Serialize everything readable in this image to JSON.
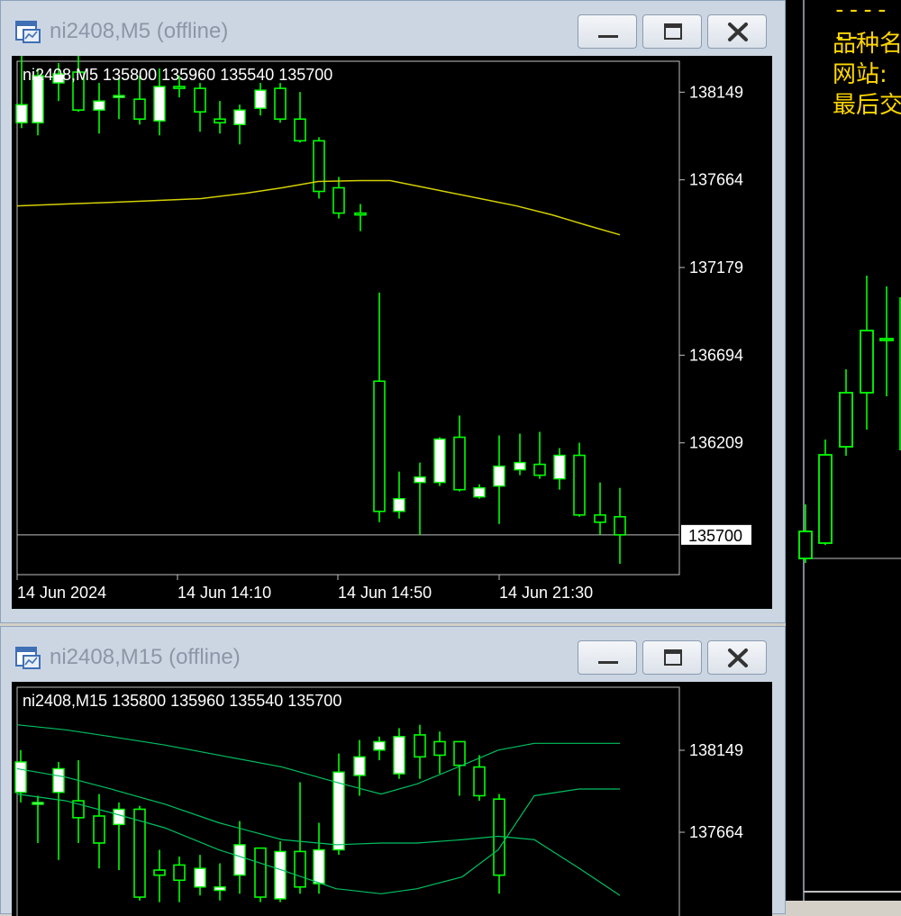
{
  "colors": {
    "chart_bg": "#000000",
    "bull_body": "#ffffff",
    "wick": "#00ff00",
    "ma_line": "#d4d000",
    "band_line": "#00c060",
    "grid_line": "#c0c0c0",
    "right_panel_text": "#ffd700"
  },
  "window_m5": {
    "title": "ni2408,M5 (offline)",
    "icon": "chart-window-icon",
    "buttons": [
      "minimize-icon",
      "maximize-icon",
      "close-icon"
    ],
    "info_line": "ni2408,M5  135800 135960 135540 135700",
    "price_labels": [
      "138149",
      "137664",
      "137179",
      "136694",
      "136209"
    ],
    "current_price": "135700",
    "time_labels": [
      "14 Jun 2024",
      "14 Jun 14:10",
      "14 Jun 14:50",
      "14 Jun 21:30"
    ]
  },
  "window_m15": {
    "title": "ni2408,M15 (offline)",
    "icon": "chart-window-icon",
    "buttons": [
      "minimize-icon",
      "maximize-icon",
      "close-icon"
    ],
    "info_line": "ni2408,M15  135800 135960 135540 135700",
    "price_labels": [
      "138149",
      "137664"
    ]
  },
  "right_panel": {
    "lines": [
      "品种名",
      "网站:",
      "最后交"
    ]
  },
  "chart_data": [
    {
      "type": "candlestick",
      "symbol": "ni2408",
      "timeframe": "M5",
      "ylim": [
        135480,
        138400
      ],
      "yticks": [
        138149,
        137664,
        137179,
        136694,
        136209
      ],
      "last_price": 135700,
      "candles": [
        {
          "o": 137980,
          "c": 138080,
          "h": 138350,
          "l": 137950
        },
        {
          "o": 137980,
          "c": 138240,
          "h": 138280,
          "l": 137910
        },
        {
          "o": 138200,
          "c": 138250,
          "h": 138310,
          "l": 138100
        },
        {
          "o": 138260,
          "c": 138050,
          "h": 138370,
          "l": 138040
        },
        {
          "o": 138050,
          "c": 138100,
          "h": 138200,
          "l": 137920
        },
        {
          "o": 138120,
          "c": 138130,
          "h": 138230,
          "l": 138000
        },
        {
          "o": 138110,
          "c": 138000,
          "h": 138240,
          "l": 137970
        },
        {
          "o": 137990,
          "c": 138180,
          "h": 138280,
          "l": 137910
        },
        {
          "o": 138180,
          "c": 138170,
          "h": 138240,
          "l": 138120
        },
        {
          "o": 138170,
          "c": 138040,
          "h": 138200,
          "l": 137930
        },
        {
          "o": 138000,
          "c": 137980,
          "h": 138100,
          "l": 137920
        },
        {
          "o": 137970,
          "c": 138050,
          "h": 138080,
          "l": 137860
        },
        {
          "o": 138060,
          "c": 138160,
          "h": 138200,
          "l": 138020
        },
        {
          "o": 138170,
          "c": 138000,
          "h": 138200,
          "l": 137980
        },
        {
          "o": 138000,
          "c": 137880,
          "h": 138150,
          "l": 137870
        },
        {
          "o": 137880,
          "c": 137600,
          "h": 137900,
          "l": 137560
        },
        {
          "o": 137620,
          "c": 137480,
          "h": 137680,
          "l": 137450
        },
        {
          "o": 137480,
          "c": 137470,
          "h": 137530,
          "l": 137380
        },
        {
          "o": 136550,
          "c": 135830,
          "h": 137040,
          "l": 135770
        },
        {
          "o": 135830,
          "c": 135900,
          "h": 136050,
          "l": 135790
        },
        {
          "o": 135990,
          "c": 136020,
          "h": 136100,
          "l": 135700
        },
        {
          "o": 135990,
          "c": 136230,
          "h": 136240,
          "l": 135970
        },
        {
          "o": 136240,
          "c": 135950,
          "h": 136360,
          "l": 135940
        },
        {
          "o": 135910,
          "c": 135960,
          "h": 135980,
          "l": 135900
        },
        {
          "o": 135970,
          "c": 136080,
          "h": 136250,
          "l": 135760
        },
        {
          "o": 136060,
          "c": 136100,
          "h": 136260,
          "l": 136030
        },
        {
          "o": 136090,
          "c": 136030,
          "h": 136270,
          "l": 136010
        },
        {
          "o": 136010,
          "c": 136140,
          "h": 136180,
          "l": 135950
        },
        {
          "o": 136140,
          "c": 135810,
          "h": 136210,
          "l": 135800
        },
        {
          "o": 135810,
          "c": 135770,
          "h": 135990,
          "l": 135700
        },
        {
          "o": 135800,
          "c": 135700,
          "h": 135960,
          "l": 135540
        }
      ],
      "moving_average": [
        137520,
        137530,
        137545,
        137560,
        137590,
        137620,
        137655,
        137660,
        137660,
        137610,
        137560,
        137520,
        137470,
        137410,
        137360
      ]
    },
    {
      "type": "candlestick",
      "symbol": "ni2408",
      "timeframe": "M15",
      "ylim": [
        137250,
        138450
      ],
      "yticks": [
        138149,
        137664
      ],
      "candles": [
        {
          "o": 137900,
          "c": 138080,
          "h": 138150,
          "l": 137840
        },
        {
          "o": 137830,
          "c": 137840,
          "h": 137880,
          "l": 137600
        },
        {
          "o": 137900,
          "c": 138040,
          "h": 138080,
          "l": 137500
        },
        {
          "o": 137850,
          "c": 137750,
          "h": 138090,
          "l": 137600
        },
        {
          "o": 137760,
          "c": 137600,
          "h": 137890,
          "l": 137450
        },
        {
          "o": 137710,
          "c": 137800,
          "h": 137840,
          "l": 137440
        },
        {
          "o": 137800,
          "c": 137280,
          "h": 137820,
          "l": 137260
        },
        {
          "o": 137440,
          "c": 137410,
          "h": 137560,
          "l": 137250
        },
        {
          "o": 137470,
          "c": 137380,
          "h": 137520,
          "l": 137250
        },
        {
          "o": 137340,
          "c": 137450,
          "h": 137530,
          "l": 137290
        },
        {
          "o": 137320,
          "c": 137340,
          "h": 137480,
          "l": 137260
        },
        {
          "o": 137410,
          "c": 137590,
          "h": 137730,
          "l": 137300
        },
        {
          "o": 137570,
          "c": 137280,
          "h": 137570,
          "l": 137250
        },
        {
          "o": 137270,
          "c": 137550,
          "h": 137610,
          "l": 137250
        },
        {
          "o": 137550,
          "c": 137340,
          "h": 137960,
          "l": 137300
        },
        {
          "o": 137360,
          "c": 137560,
          "h": 137720,
          "l": 137300
        },
        {
          "o": 137560,
          "c": 138020,
          "h": 138130,
          "l": 137530
        },
        {
          "o": 138000,
          "c": 138110,
          "h": 138210,
          "l": 137880
        },
        {
          "o": 138150,
          "c": 138200,
          "h": 138230,
          "l": 138090
        },
        {
          "o": 138010,
          "c": 138230,
          "h": 138280,
          "l": 137980
        },
        {
          "o": 138240,
          "c": 138110,
          "h": 138300,
          "l": 137980
        },
        {
          "o": 138200,
          "c": 138120,
          "h": 138260,
          "l": 138010
        },
        {
          "o": 138200,
          "c": 138060,
          "h": 138200,
          "l": 137880
        },
        {
          "o": 138050,
          "c": 137880,
          "h": 138120,
          "l": 137850
        },
        {
          "o": 137860,
          "c": 137410,
          "h": 137890,
          "l": 137300
        }
      ],
      "bollinger_upper": [
        138300,
        138270,
        138230,
        138180,
        138120,
        138050,
        137960,
        137890,
        137950,
        138060,
        138150,
        138190,
        138190,
        138190
      ],
      "bollinger_middle": [
        138040,
        137990,
        137920,
        137830,
        137720,
        137620,
        137590,
        137600,
        137600,
        137620,
        137640,
        137620,
        137450,
        137290
      ],
      "bollinger_lower": [
        137890,
        137850,
        137780,
        137690,
        137560,
        137440,
        137330,
        137300,
        137330,
        137400,
        137560,
        137880,
        137920,
        137920
      ]
    }
  ]
}
